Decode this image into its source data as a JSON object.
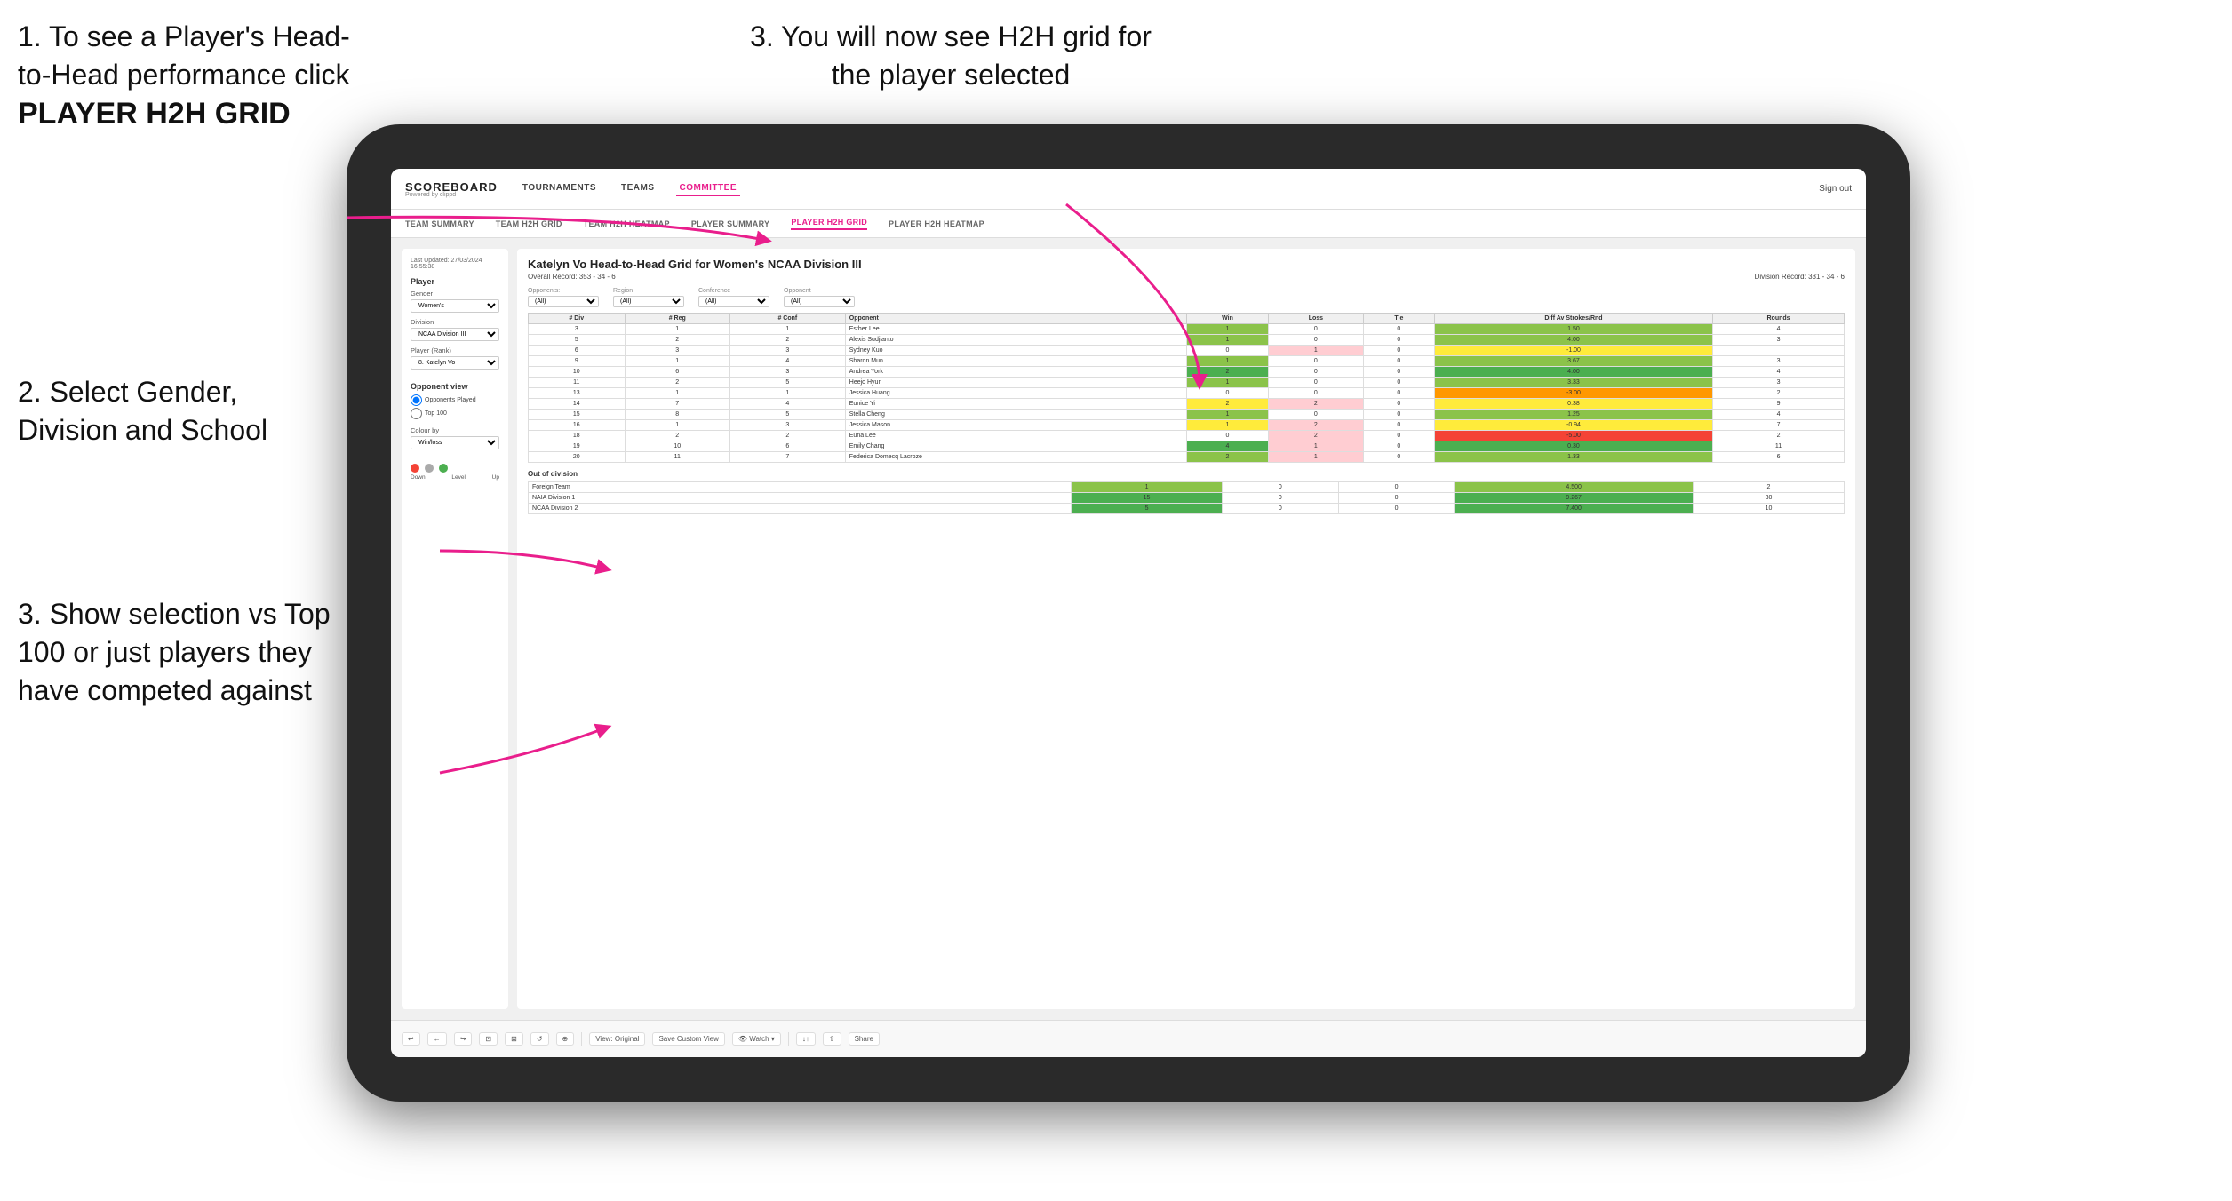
{
  "instructions": {
    "top_left_1": "1. To see a Player's Head-to-Head performance click",
    "top_left_bold": "PLAYER H2H GRID",
    "top_right": "3. You will now see H2H grid for the player selected",
    "mid_left_num": "2. Select Gender, Division and School",
    "bot_left_num": "3. Show selection vs Top 100 or just players they have competed against"
  },
  "nav": {
    "logo": "SCOREBOARD",
    "logo_sub": "Powered by clippd",
    "items": [
      "TOURNAMENTS",
      "TEAMS",
      "COMMITTEE"
    ],
    "active_item": "COMMITTEE",
    "sign_out": "Sign out"
  },
  "secondary_nav": {
    "items": [
      "TEAM SUMMARY",
      "TEAM H2H GRID",
      "TEAM H2H HEATMAP",
      "PLAYER SUMMARY",
      "PLAYER H2H GRID",
      "PLAYER H2H HEATMAP"
    ],
    "active": "PLAYER H2H GRID"
  },
  "sidebar": {
    "timestamp": "Last Updated: 27/03/2024 16:55:38",
    "player_label": "Player",
    "gender_label": "Gender",
    "gender_value": "Women's",
    "division_label": "Division",
    "division_value": "NCAA Division III",
    "player_rank_label": "Player (Rank)",
    "player_rank_value": "8. Katelyn Vo",
    "opponent_view_label": "Opponent view",
    "radio1": "Opponents Played",
    "radio2": "Top 100",
    "colour_by_label": "Colour by",
    "colour_by_value": "Win/loss",
    "legend_down": "Down",
    "legend_level": "Level",
    "legend_up": "Up"
  },
  "main": {
    "title": "Katelyn Vo Head-to-Head Grid for Women's NCAA Division III",
    "overall_record": "Overall Record: 353 - 34 - 6",
    "division_record": "Division Record: 331 - 34 - 6",
    "opponents_label": "Opponents:",
    "region_label": "Region",
    "conference_label": "Conference",
    "opponent_label": "Opponent",
    "filter_all": "(All)",
    "columns": [
      "# Div",
      "# Reg",
      "# Conf",
      "Opponent",
      "Win",
      "Loss",
      "Tie",
      "Diff Av Strokes/Rnd",
      "Rounds"
    ],
    "rows": [
      {
        "div": 3,
        "reg": 1,
        "conf": 1,
        "opponent": "Esther Lee",
        "win": 1,
        "loss": 0,
        "tie": 0,
        "diff": "1.50",
        "rounds": 4,
        "win_color": "green"
      },
      {
        "div": 5,
        "reg": 2,
        "conf": 2,
        "opponent": "Alexis Sudjianto",
        "win": 1,
        "loss": 0,
        "tie": 0,
        "diff": "4.00",
        "rounds": 3,
        "win_color": "green"
      },
      {
        "div": 6,
        "reg": 3,
        "conf": 3,
        "opponent": "Sydney Kuo",
        "win": 0,
        "loss": 1,
        "tie": 0,
        "diff": "-1.00",
        "rounds": "",
        "win_color": "yellow"
      },
      {
        "div": 9,
        "reg": 1,
        "conf": 4,
        "opponent": "Sharon Mun",
        "win": 1,
        "loss": 0,
        "tie": 0,
        "diff": "3.67",
        "rounds": 3,
        "win_color": "green"
      },
      {
        "div": 10,
        "reg": 6,
        "conf": 3,
        "opponent": "Andrea York",
        "win": 2,
        "loss": 0,
        "tie": 0,
        "diff": "4.00",
        "rounds": 4,
        "win_color": "green-dark"
      },
      {
        "div": 11,
        "reg": 2,
        "conf": 5,
        "opponent": "Heejo Hyun",
        "win": 1,
        "loss": 0,
        "tie": 0,
        "diff": "3.33",
        "rounds": 3,
        "win_color": "green"
      },
      {
        "div": 13,
        "reg": 1,
        "conf": 1,
        "opponent": "Jessica Huang",
        "win": 0,
        "loss": 0,
        "tie": 0,
        "diff": "-3.00",
        "rounds": 2,
        "win_color": "orange"
      },
      {
        "div": 14,
        "reg": 7,
        "conf": 4,
        "opponent": "Eunice Yi",
        "win": 2,
        "loss": 2,
        "tie": 0,
        "diff": "0.38",
        "rounds": 9,
        "win_color": "yellow"
      },
      {
        "div": 15,
        "reg": 8,
        "conf": 5,
        "opponent": "Stella Cheng",
        "win": 1,
        "loss": 0,
        "tie": 0,
        "diff": "1.25",
        "rounds": 4,
        "win_color": "green"
      },
      {
        "div": 16,
        "reg": 1,
        "conf": 3,
        "opponent": "Jessica Mason",
        "win": 1,
        "loss": 2,
        "tie": 0,
        "diff": "-0.94",
        "rounds": 7,
        "win_color": "yellow"
      },
      {
        "div": 18,
        "reg": 2,
        "conf": 2,
        "opponent": "Euna Lee",
        "win": 0,
        "loss": 2,
        "tie": 0,
        "diff": "-5.00",
        "rounds": 2,
        "win_color": "red"
      },
      {
        "div": 19,
        "reg": 10,
        "conf": 6,
        "opponent": "Emily Chang",
        "win": 4,
        "loss": 1,
        "tie": 0,
        "diff": "0.30",
        "rounds": 11,
        "win_color": "green-dark"
      },
      {
        "div": 20,
        "reg": 11,
        "conf": 7,
        "opponent": "Federica Domecq Lacroze",
        "win": 2,
        "loss": 1,
        "tie": 0,
        "diff": "1.33",
        "rounds": 6,
        "win_color": "green"
      }
    ],
    "out_of_division_label": "Out of division",
    "out_rows": [
      {
        "label": "Foreign Team",
        "win": 1,
        "loss": 0,
        "tie": 0,
        "diff": "4.500",
        "rounds": 2,
        "win_color": "green"
      },
      {
        "label": "NAIA Division 1",
        "win": 15,
        "loss": 0,
        "tie": 0,
        "diff": "9.267",
        "rounds": 30,
        "win_color": "green-dark"
      },
      {
        "label": "NCAA Division 2",
        "win": 5,
        "loss": 0,
        "tie": 0,
        "diff": "7.400",
        "rounds": 10,
        "win_color": "green-dark"
      }
    ]
  },
  "toolbar": {
    "buttons": [
      "↩",
      "←",
      "↪",
      "⊡",
      "⊠",
      "↺",
      "⊕",
      "View: Original",
      "Save Custom View",
      "Watch ▾",
      "↓↑",
      "⇧",
      "Share"
    ]
  }
}
